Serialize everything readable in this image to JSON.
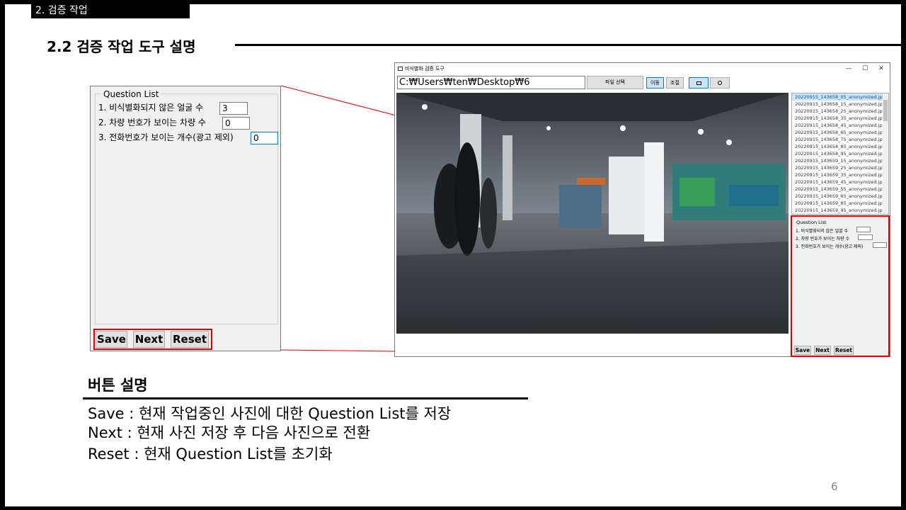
{
  "section_tag": "2. 검증 작업",
  "heading": "2.2 검증 작업 도구 설명",
  "zoom": {
    "legend": "Question List",
    "questions": [
      {
        "label": "1. 비식별화되지 않은 얼굴 수",
        "value": "3"
      },
      {
        "label": "2. 차량 번호가 보이는 차량 수",
        "value": "0"
      },
      {
        "label": "3. 전화번호가 보이는 개수(광고 제외)",
        "value": "0"
      }
    ],
    "buttons": {
      "save": "Save",
      "next": "Next",
      "reset": "Reset"
    }
  },
  "window": {
    "title": "비식별화 검증 도구",
    "controls": {
      "minimize": "—",
      "maximize": "☐",
      "close": "✕"
    },
    "path": "C:₩Users₩ten₩Desktop₩6",
    "file_button": "파일 선택",
    "toolbar": {
      "move": "이동",
      "adjust": "조절",
      "rect": "▫",
      "circle": "◦"
    },
    "files": [
      "20220915_143658_05_anonymized.jpg",
      "20220915_143658_15_anonymized.jpg",
      "20220915_143658_25_anonymized.jpg",
      "20220915_143658_35_anonymized.jpg",
      "20220915_143658_45_anonymized.jpg",
      "20220915_143658_65_anonymized.jpg",
      "20220915_143658_75_anonymized.jpg",
      "20220915_143658_85_anonymized.jpg",
      "20220915_143658_95_anonymized.jpg",
      "20220915_143659_15_anonymized.jpg",
      "20220915_143659_25_anonymized.jpg",
      "20220915_143659_35_anonymized.jpg",
      "20220915_143659_45_anonymized.jpg",
      "20220915_143659_55_anonymized.jpg",
      "20220915_143659_65_anonymized.jpg",
      "20220915_143659_85_anonymized.jpg",
      "20220915_143659_95_anonymized.jpg"
    ],
    "mini": {
      "legend": "Question List",
      "q1": "1. 비식별화되지 않은 얼굴 수",
      "q2": "2. 차량 번호가 보이는 차량 수",
      "q3": "3. 전화번호가 보이는 개수(광고 제외)",
      "save": "Save",
      "next": "Next",
      "reset": "Reset"
    }
  },
  "description": {
    "title": "버튼 설명",
    "lines": [
      "Save : 현재 작업중인 사진에 대한 Question List를 저장",
      "Next : 현재 사진 저장 후 다음 사진으로 전환",
      "Reset : 현재 Question List를 초기화"
    ]
  },
  "page_number": "6",
  "colors": {
    "highlight": "#dd0000",
    "accent": "#0078d7"
  }
}
